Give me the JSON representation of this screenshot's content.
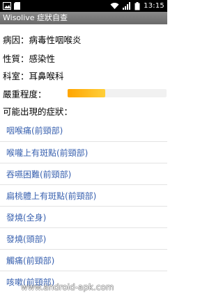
{
  "status_bar": {
    "time": "13:15",
    "left_icons": [
      "gallery-icon",
      "sd-card-icon"
    ],
    "right_icons": [
      "wifi-icon",
      "signal-icon",
      "battery-icon"
    ]
  },
  "title_bar": {
    "title": "Wisolive 症狀自查"
  },
  "info": {
    "cause": "病因：病毒性咽喉炎",
    "nature": "性質：感染性",
    "department": "科室：耳鼻喉科",
    "severity_label": "嚴重程度：",
    "severity_level": 0.38,
    "symptoms_heading": "可能出現的症狀："
  },
  "symptoms": [
    "咽喉痛(前頸部)",
    "喉嚨上有斑點(前頸部)",
    "吞嚥困難(前頸部)",
    "扁桃體上有斑點(前頸部)",
    "發燒(全身)",
    "發燒(頭部)",
    "觸痛(前頸部)",
    "咳嗽(前頸部)"
  ],
  "watermark": "www.android-apk.com",
  "colors": {
    "link": "#3a62b0",
    "severity_start": "#ffa500",
    "severity_end": "#ffcf3a"
  }
}
